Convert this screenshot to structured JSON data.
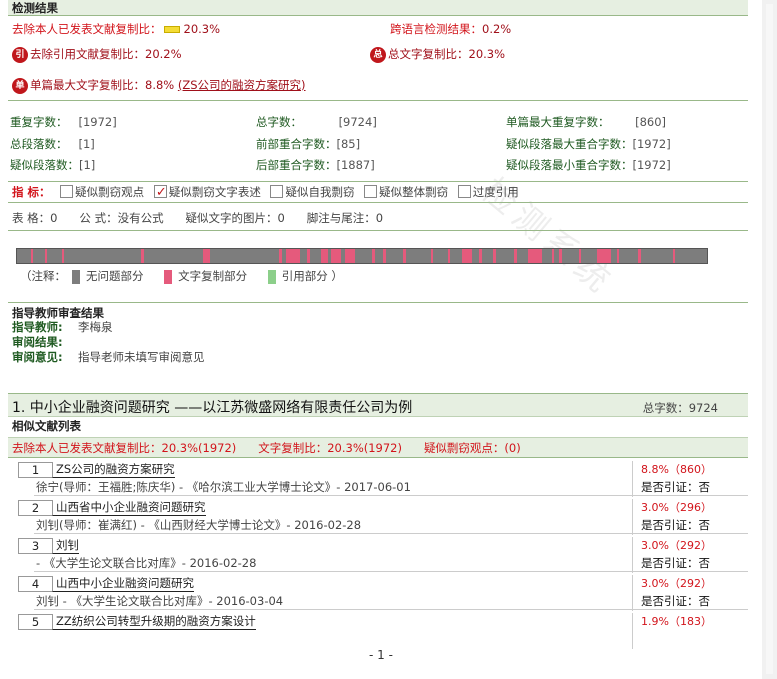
{
  "section_header": "检测结果",
  "line1": {
    "excl_self_label": "去除本人已发表文献复制比：",
    "excl_self_value": "20.3%",
    "cross_lang_label": "跨语言检测结果：",
    "cross_lang_value": "0.2%"
  },
  "line2": {
    "icon_a": "引",
    "excl_ref_label": "去除引用文献复制比：",
    "excl_ref_value": "20.2%",
    "icon_b": "总",
    "total_label": "总文字复制比：",
    "total_value": "20.3%"
  },
  "line3": {
    "icon": "单",
    "label": "单篇最大文字复制比：",
    "value": "8.8%",
    "link": "(ZS公司的融资方案研究)"
  },
  "stats": [
    {
      "k": "重复字数：",
      "v": "[1972]"
    },
    {
      "k": "总字数：",
      "v": "[9724]"
    },
    {
      "k": "单篇最大重复字数：",
      "v": "[860]"
    },
    {
      "k": "总段落数：",
      "v": "[1]"
    },
    {
      "k": "前部重合字数：",
      "v": "[85]"
    },
    {
      "k": "疑似段落最大重合字数：",
      "v": "[1972]"
    },
    {
      "k": "疑似段落数：",
      "v": "[1]"
    },
    {
      "k": "后部重合字数：",
      "v": "[1887]"
    },
    {
      "k": "疑似段落最小重合字数：",
      "v": "[1972]"
    }
  ],
  "indicators": {
    "label": "指 标：",
    "items": [
      {
        "label": "疑似剽窃观点",
        "checked": false
      },
      {
        "label": "疑似剽窃文字表述",
        "checked": true
      },
      {
        "label": "疑似自我剽窃",
        "checked": false
      },
      {
        "label": "疑似整体剽窃",
        "checked": false
      },
      {
        "label": "过度引用",
        "checked": false
      }
    ]
  },
  "table_line": {
    "table": "表 格：0",
    "formula": "公 式：没有公式",
    "images": "疑似文字的图片：0",
    "footnotes": "脚注与尾注：0"
  },
  "heatmap": {
    "colors": {
      "none": "#7d7d7d",
      "copy": "#e55a7c",
      "cite": "#8ccf8a"
    },
    "copy_segments": [
      [
        0.02,
        0.02
      ],
      [
        0.04,
        0.03
      ],
      [
        0.065,
        0.068
      ],
      [
        0.18,
        0.184
      ],
      [
        0.27,
        0.28
      ],
      [
        0.38,
        0.385
      ],
      [
        0.39,
        0.41
      ],
      [
        0.42,
        0.425
      ],
      [
        0.44,
        0.45
      ],
      [
        0.455,
        0.47
      ],
      [
        0.475,
        0.49
      ],
      [
        0.515,
        0.52
      ],
      [
        0.53,
        0.535
      ],
      [
        0.56,
        0.565
      ],
      [
        0.6,
        0.603
      ],
      [
        0.625,
        0.628
      ],
      [
        0.645,
        0.66
      ],
      [
        0.67,
        0.674
      ],
      [
        0.69,
        0.694
      ],
      [
        0.72,
        0.725
      ],
      [
        0.74,
        0.76
      ],
      [
        0.775,
        0.778
      ],
      [
        0.785,
        0.79
      ],
      [
        0.815,
        0.818
      ],
      [
        0.84,
        0.86
      ],
      [
        0.87,
        0.873
      ],
      [
        0.9,
        0.905
      ],
      [
        0.95,
        0.953
      ]
    ]
  },
  "legend": {
    "prefix": "（注释：",
    "none": "无问题部分",
    "copy": "文字复制部分",
    "cite": "引用部分",
    "suffix": "）"
  },
  "review": {
    "header": "指导教师审查结果",
    "teacher_label": "指导教师:",
    "teacher_value": "李梅泉",
    "result_label": "审阅结果:",
    "result_value": "",
    "opinion_label": "审阅意见:",
    "opinion_value": "指导老师未填写审阅意见"
  },
  "paper": {
    "title": "1. 中小企业融资问题研究 ——以江苏微盛网络有限责任公司为例",
    "total_chars": "总字数：9724",
    "list_header": "相似文献列表",
    "band_excl": "去除本人已发表文献复制比：20.3%(1972)",
    "band_copy": "文字复制比：20.3%(1972)",
    "band_plag": "疑似剽窃观点：(0)"
  },
  "refs": [
    {
      "num": "1",
      "title": "ZS公司的融资方案研究",
      "meta": "徐宁(导师：王福胜;陈庆华) - 《哈尔滨工业大学博士论文》- 2017-06-01",
      "pct": "8.8%（860）",
      "cite": "是否引证：否"
    },
    {
      "num": "2",
      "title": "山西省中小企业融资问题研究",
      "meta": "刘钊(导师：崔满红) - 《山西财经大学博士论文》- 2016-02-28",
      "pct": "3.0%（296）",
      "cite": "是否引证：否"
    },
    {
      "num": "3",
      "title": "刘钊",
      "meta": "- 《大学生论文联合比对库》- 2016-02-28",
      "pct": "3.0%（292）",
      "cite": "是否引证：否"
    },
    {
      "num": "4",
      "title": "山西中小企业融资问题研究",
      "meta": "刘钊 - 《大学生论文联合比对库》- 2016-03-04",
      "pct": "3.0%（292）",
      "cite": "是否引证：否"
    },
    {
      "num": "5",
      "title": "ZZ纺织公司转型升级期的融资方案设计",
      "meta": "",
      "pct": "1.9%（183）",
      "cite": ""
    }
  ],
  "footer": "- 1 -",
  "watermark": "检测系统"
}
